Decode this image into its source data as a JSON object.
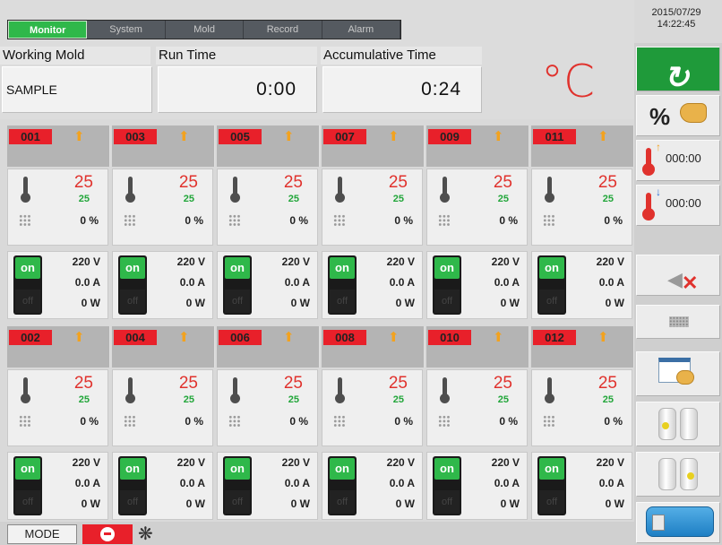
{
  "tabs": [
    "Monitor",
    "System",
    "Mold",
    "Record",
    "Alarm"
  ],
  "active_tab": 0,
  "datetime": {
    "date": "2015/07/29",
    "time": "14:22:45"
  },
  "info": {
    "working_mold_label": "Working Mold",
    "working_mold_value": "SAMPLE",
    "run_time_label": "Run Time",
    "run_time_value": "0:00",
    "accumulative_time_label": "Accumulative Time",
    "accumulative_time_value": "0:24",
    "unit": "°C"
  },
  "zones_row1": [
    {
      "id": "001",
      "pv": "25",
      "sv": "25",
      "output": "0 %",
      "state_on": "on",
      "state_off": "off",
      "voltage": "220 V",
      "current": "0.0 A",
      "power": "0 W"
    },
    {
      "id": "003",
      "pv": "25",
      "sv": "25",
      "output": "0 %",
      "state_on": "on",
      "state_off": "off",
      "voltage": "220 V",
      "current": "0.0 A",
      "power": "0 W"
    },
    {
      "id": "005",
      "pv": "25",
      "sv": "25",
      "output": "0 %",
      "state_on": "on",
      "state_off": "off",
      "voltage": "220 V",
      "current": "0.0 A",
      "power": "0 W"
    },
    {
      "id": "007",
      "pv": "25",
      "sv": "25",
      "output": "0 %",
      "state_on": "on",
      "state_off": "off",
      "voltage": "220 V",
      "current": "0.0 A",
      "power": "0 W"
    },
    {
      "id": "009",
      "pv": "25",
      "sv": "25",
      "output": "0 %",
      "state_on": "on",
      "state_off": "off",
      "voltage": "220 V",
      "current": "0.0 A",
      "power": "0 W"
    },
    {
      "id": "011",
      "pv": "25",
      "sv": "25",
      "output": "0 %",
      "state_on": "on",
      "state_off": "off",
      "voltage": "220 V",
      "current": "0.0 A",
      "power": "0 W"
    }
  ],
  "zones_row2": [
    {
      "id": "002",
      "pv": "25",
      "sv": "25",
      "output": "0 %",
      "state_on": "on",
      "state_off": "off",
      "voltage": "220 V",
      "current": "0.0 A",
      "power": "0 W"
    },
    {
      "id": "004",
      "pv": "25",
      "sv": "25",
      "output": "0 %",
      "state_on": "on",
      "state_off": "off",
      "voltage": "220 V",
      "current": "0.0 A",
      "power": "0 W"
    },
    {
      "id": "006",
      "pv": "25",
      "sv": "25",
      "output": "0 %",
      "state_on": "on",
      "state_off": "off",
      "voltage": "220 V",
      "current": "0.0 A",
      "power": "0 W"
    },
    {
      "id": "008",
      "pv": "25",
      "sv": "25",
      "output": "0 %",
      "state_on": "on",
      "state_off": "off",
      "voltage": "220 V",
      "current": "0.0 A",
      "power": "0 W"
    },
    {
      "id": "010",
      "pv": "25",
      "sv": "25",
      "output": "0 %",
      "state_on": "on",
      "state_off": "off",
      "voltage": "220 V",
      "current": "0.0 A",
      "power": "0 W"
    },
    {
      "id": "012",
      "pv": "25",
      "sv": "25",
      "output": "0 %",
      "state_on": "on",
      "state_off": "off",
      "voltage": "220 V",
      "current": "0.0 A",
      "power": "0 W"
    }
  ],
  "side_panel": {
    "percent_symbol": "%",
    "rise_timer": "000:00",
    "fall_timer": "000:00",
    "icons": [
      "cycle-icon",
      "percent-hand-icon",
      "temp-rise-icon",
      "temp-fall-icon",
      "mute-icon",
      "keyboard-icon",
      "calendar-icon",
      "roll-left-icon",
      "roll-right-icon",
      "usb-icon"
    ]
  },
  "status": {
    "mode_label": "MODE"
  },
  "colors": {
    "accent_green": "#2fb84a",
    "alarm_red": "#e8202a",
    "temp_red": "#e0322d",
    "setpoint_green": "#22a63a"
  }
}
